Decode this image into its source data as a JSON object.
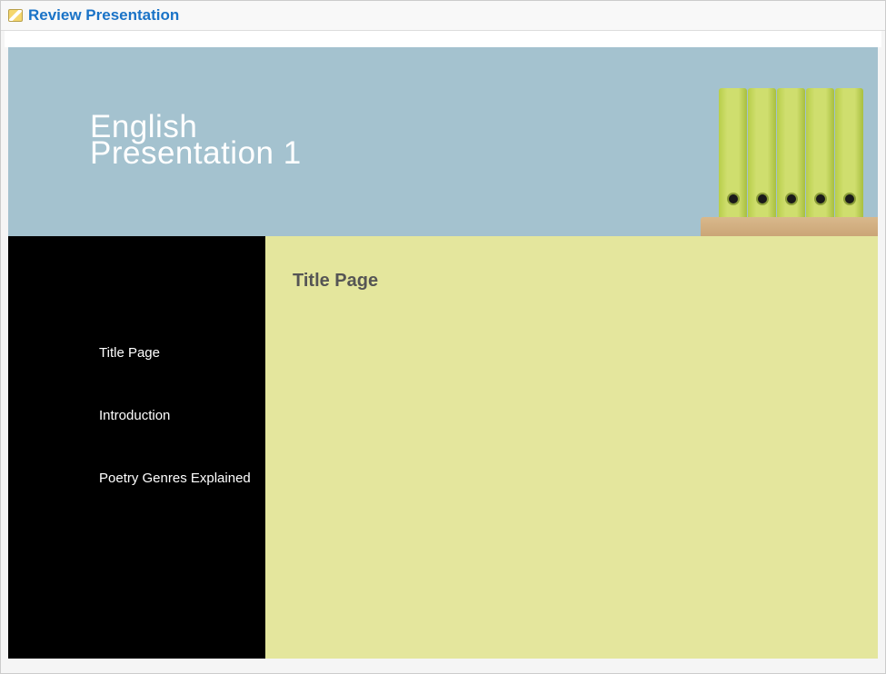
{
  "header": {
    "link_text": "Review Presentation"
  },
  "banner": {
    "title_line1": "English",
    "title_line2": "Presentation 1"
  },
  "sidebar": {
    "items": [
      {
        "label": "Title Page"
      },
      {
        "label": "Introduction"
      },
      {
        "label": "Poetry Genres Explained"
      }
    ]
  },
  "content": {
    "title": "Title Page"
  }
}
